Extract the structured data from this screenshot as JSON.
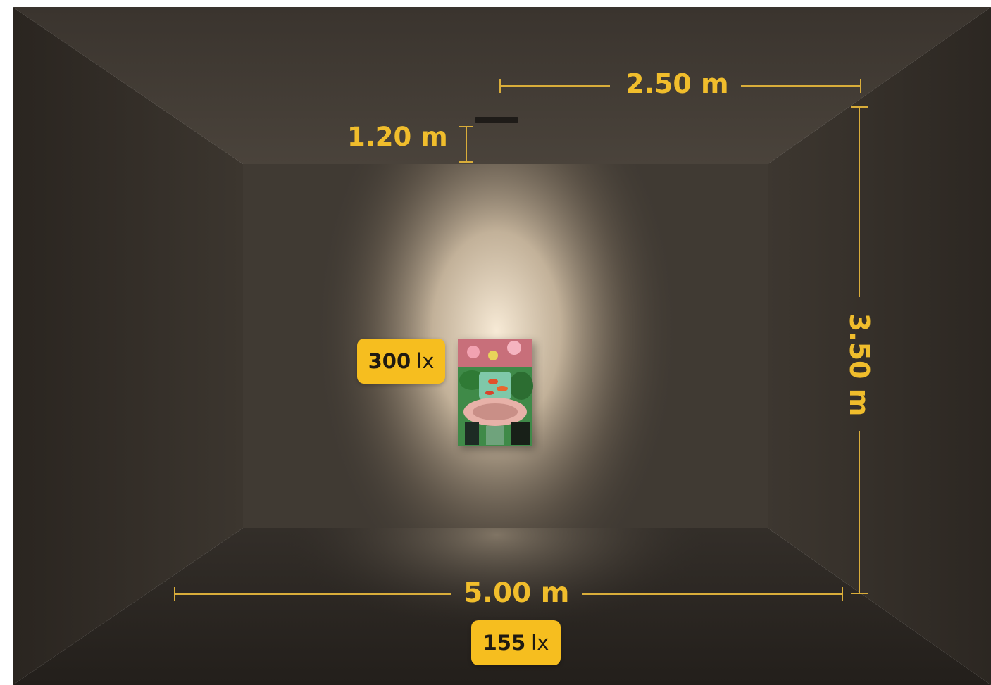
{
  "dimensions": {
    "ceiling_depth": "2.50 m",
    "spot_offset": "1.20 m",
    "wall_height": "3.50 m",
    "room_width": "5.00 m"
  },
  "illuminance": {
    "wall": {
      "value": "300",
      "unit": "lx"
    },
    "floor": {
      "value": "155",
      "unit": "lx"
    }
  },
  "colors": {
    "accent": "#f6be1f",
    "dimension_line": "#d9ad3a",
    "wall_back": "#3f3a34",
    "light": "#f6e8d2"
  },
  "icons": [
    "downlight-fixture-icon",
    "painting-artwork"
  ]
}
